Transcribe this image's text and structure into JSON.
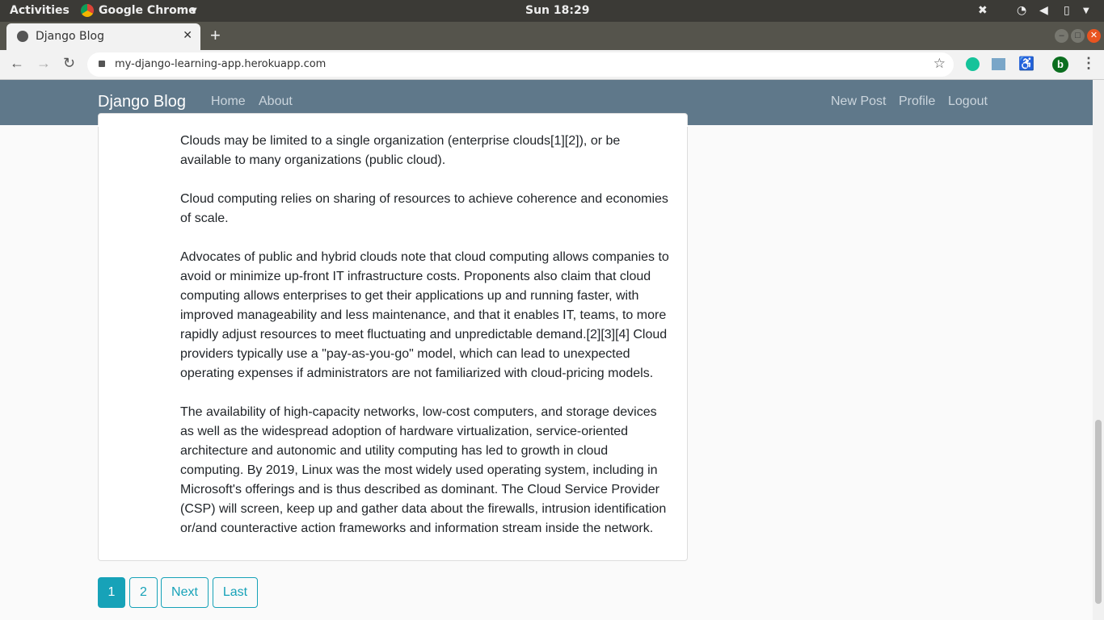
{
  "os": {
    "activities": "Activities",
    "app": "Google Chrome",
    "clock": "Sun 18:29"
  },
  "browser": {
    "tab_title": "Django Blog",
    "url": "my-django-learning-app.herokuapp.com",
    "profile_initial": "b"
  },
  "navbar": {
    "brand": "Django Blog",
    "left": [
      "Home",
      "About"
    ],
    "right": [
      "New Post",
      "Profile",
      "Logout"
    ]
  },
  "post": {
    "paragraphs": [
      "Clouds may be limited to a single organization (enterprise clouds[1][2]), or be available to many organizations (public cloud).",
      "Cloud computing relies on sharing of resources to achieve coherence and economies of scale.",
      "Advocates of public and hybrid clouds note that cloud computing allows companies to avoid or minimize up-front IT infrastructure costs. Proponents also claim that cloud computing allows enterprises to get their applications up and running faster, with improved manageability and less maintenance, and that it enables IT, teams, to more rapidly adjust resources to meet fluctuating and unpredictable demand.[2][3][4] Cloud providers typically use a \"pay-as-you-go\" model, which can lead to unexpected operating expenses if administrators are not familiarized with cloud-pricing models.",
      "The availability of high-capacity networks, low-cost computers, and storage devices as well as the widespread adoption of hardware virtualization, service-oriented architecture and autonomic and utility computing has led to growth in cloud computing. By 2019, Linux was the most widely used operating system, including in Microsoft's offerings and is thus described as dominant. The Cloud Service Provider (CSP) will screen, keep up and gather data about the firewalls, intrusion identification or/and counteractive action frameworks and information stream inside the network."
    ]
  },
  "pagination": {
    "pages": [
      "1",
      "2"
    ],
    "next": "Next",
    "last": "Last",
    "current": "1"
  }
}
